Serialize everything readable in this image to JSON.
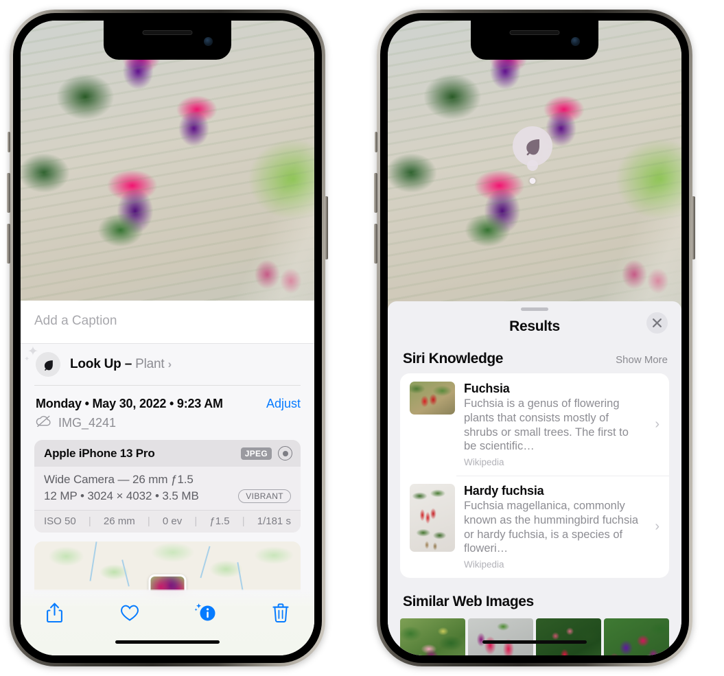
{
  "left_phone": {
    "name": "photos-detail-screen",
    "caption": {
      "placeholder": "Add a Caption",
      "value": ""
    },
    "look_up": {
      "label": "Look Up",
      "dash": "–",
      "subject": "Plant",
      "chevron": "›",
      "icon": "leaf-icon",
      "sparkle": "✦"
    },
    "metadata": {
      "date_line": "Monday • May 30, 2022 • 9:23 AM",
      "adjust_label": "Adjust",
      "file_name": "IMG_4241",
      "cloud_icon": "icloud-slash-icon"
    },
    "camera_card": {
      "device": "Apple iPhone 13 Pro",
      "format_tag": "JPEG",
      "raw_icon": "aperture-icon",
      "lens_line": "Wide Camera — 26 mm ƒ1.5",
      "detail_line": "12 MP • 3024 × 4032 • 3.5 MB",
      "style_tag": "VIBRANT",
      "stats": [
        "ISO 50",
        "26 mm",
        "0 ev",
        "ƒ1.5",
        "1/181 s"
      ],
      "stat_separator": "|"
    },
    "map": {
      "name": "location-map-thumbnail"
    },
    "toolbar": [
      {
        "name": "share-button",
        "icon": "share-icon"
      },
      {
        "name": "favorite-button",
        "icon": "heart-icon"
      },
      {
        "name": "info-button",
        "icon": "info-sparkle-icon"
      },
      {
        "name": "delete-button",
        "icon": "trash-icon"
      }
    ],
    "accent_color": "#067bff"
  },
  "right_phone": {
    "name": "visual-look-up-results-screen",
    "leaf_badge": {
      "icon": "leaf-icon",
      "name": "visual-lookup-badge"
    },
    "sheet": {
      "title": "Results",
      "close_icon": "close-icon",
      "sections": [
        {
          "name": "siri-knowledge",
          "title": "Siri Knowledge",
          "action": "Show More",
          "items": [
            {
              "title": "Fuchsia",
              "description": "Fuchsia is a genus of flowering plants that consists mostly of shrubs or small trees. The first to be scientific…",
              "source": "Wikipedia",
              "chevron": "›"
            },
            {
              "title": "Hardy fuchsia",
              "description": "Fuchsia magellanica, commonly known as the hummingbird fuchsia or hardy fuchsia, is a species of floweri…",
              "source": "Wikipedia",
              "chevron": "›"
            }
          ]
        },
        {
          "name": "similar-web-images",
          "title": "Similar Web Images",
          "thumbnails": [
            {
              "name": "web-image-1"
            },
            {
              "name": "web-image-2"
            },
            {
              "name": "web-image-3"
            },
            {
              "name": "web-image-4"
            }
          ]
        }
      ]
    }
  }
}
